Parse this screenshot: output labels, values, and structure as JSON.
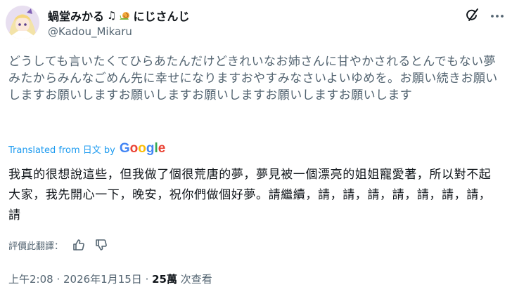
{
  "author": {
    "display_name": "蝸堂みかる",
    "display_name_suffix": "にじさんじ",
    "emoji_note": "♫",
    "emoji_snail": "🐌",
    "handle": "@Kadou_Mikaru"
  },
  "icons": {
    "grok": "grok-icon",
    "more": "more-horizontal-icon",
    "like": "thumbs-up-icon",
    "dislike": "thumbs-down-icon"
  },
  "original_text": "どうしても言いたくてひらあたんだけどきれいなお姉さんに甘やかされるとんでもない夢みたからみんなごめん先に幸せになりますおやすみなさいよいゆめを。お願い続きお願いしますお願いしますお願いしますお願いしますお願いしますお願いします",
  "translation": {
    "label": "Translated from 日文 by",
    "provider": "Google",
    "text": "我真的很想說這些，但我做了個很荒唐的夢，夢見被一個漂亮的姐姐寵愛著，所以對不起大家，我先開心一下，晚安，祝你們做個好夢。請繼續，請，請，請，請，請，請，請，請"
  },
  "rate": {
    "label": "評價此翻譯："
  },
  "meta": {
    "time": "上午2:08",
    "sep1": " · ",
    "date": "2026年1月15日",
    "sep2": " · ",
    "views": "25萬",
    "views_label": " 次查看"
  },
  "colors": {
    "text": "#0f1419",
    "secondary": "#536471",
    "link": "#1d9bf0"
  }
}
